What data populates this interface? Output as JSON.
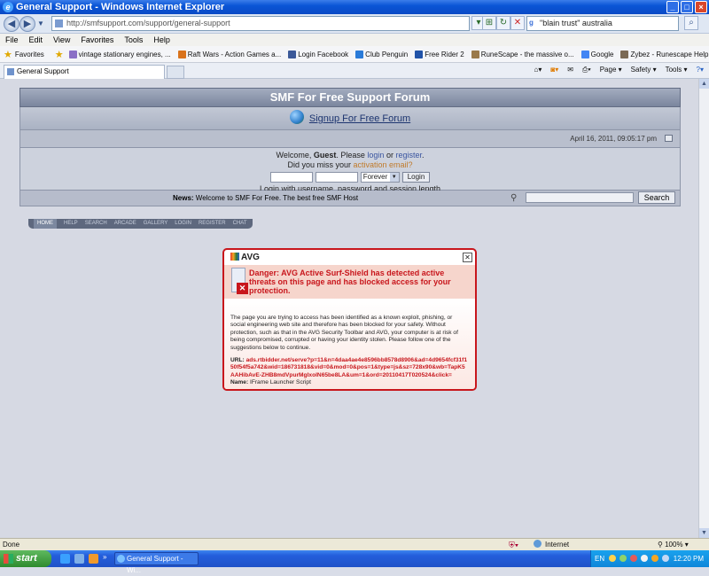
{
  "window": {
    "title": "General Support - Windows Internet Explorer"
  },
  "address": {
    "url": "http://smfsupport.com/support/general-support",
    "search_value": "\"blain trust\" australia"
  },
  "menu": [
    "File",
    "Edit",
    "View",
    "Favorites",
    "Tools",
    "Help"
  ],
  "favorites": {
    "label": "Favorites",
    "items": [
      "vintage stationary engines, ...",
      "Raft Wars - Action Games a...",
      "Login Facebook",
      "Club Penguin",
      "Free Rider 2",
      "RuneScape - the massive o...",
      "Google",
      "Zybez - Runescape Help, gu..."
    ]
  },
  "tab": {
    "label": "General Support"
  },
  "commands": [
    "Page",
    "Safety",
    "Tools"
  ],
  "forum": {
    "title": "SMF For Free Support Forum",
    "signup": "Signup For Free Forum",
    "datetime": "April 16, 2011, 09:05:17 pm",
    "welcome_pre": "Welcome, ",
    "guest": "Guest",
    "welcome_mid": ". Please ",
    "login": "login",
    "or": " or ",
    "register": "register",
    "dot": ".",
    "missed": "Did you miss your ",
    "activation": "activation email?",
    "forever": "Forever",
    "login_btn": "Login",
    "login_hint": "Login with username, password and session length",
    "news_label": "News:",
    "news_text": " Welcome to SMF For Free. The best free SMF Host",
    "search_btn": "Search",
    "nav": [
      "HOME",
      "HELP",
      "SEARCH",
      "ARCADE",
      "GALLERY",
      "LOGIN",
      "REGISTER",
      "CHAT"
    ]
  },
  "avg": {
    "brand": "AVG",
    "danger": "Danger: AVG Active Surf-Shield has detected active threats on this page and has blocked access for your protection.",
    "body": "The page you are trying to access has been identified as a known exploit, phishing, or social engineering web site and therefore has been blocked for your safety. Without protection, such as that in the AVG Security Toolbar and AVG, your computer is at risk of being compromised, corrupted or having your identity stolen. Please follow one of the suggestions below to continue.",
    "url_label": "URL:",
    "url": "ads.rtbidder.net/serve?p=11&n=4daa4ae4e8596bb8578d8906&ad=4d9654fcf31f150f54f5a742&wid=186731818&vid=0&mod=0&pos=1&type=js&sz=728x90&wb=TapK5AAHibAvE-ZHB8mdVpurMglxolN65be8LA&um=1&ord=20110417T020524&click=",
    "name_label": "Name:",
    "name": "IFrame Launcher Script"
  },
  "status": {
    "left": "Done",
    "zone": "Internet",
    "zoom": "100%"
  },
  "taskbar": {
    "start": "start",
    "task": "General Support - Wi...",
    "lang": "EN",
    "clock": "12:20 PM"
  },
  "colors": {
    "avg_red": "#c8161c",
    "ie_blue": "#0a55d6"
  }
}
